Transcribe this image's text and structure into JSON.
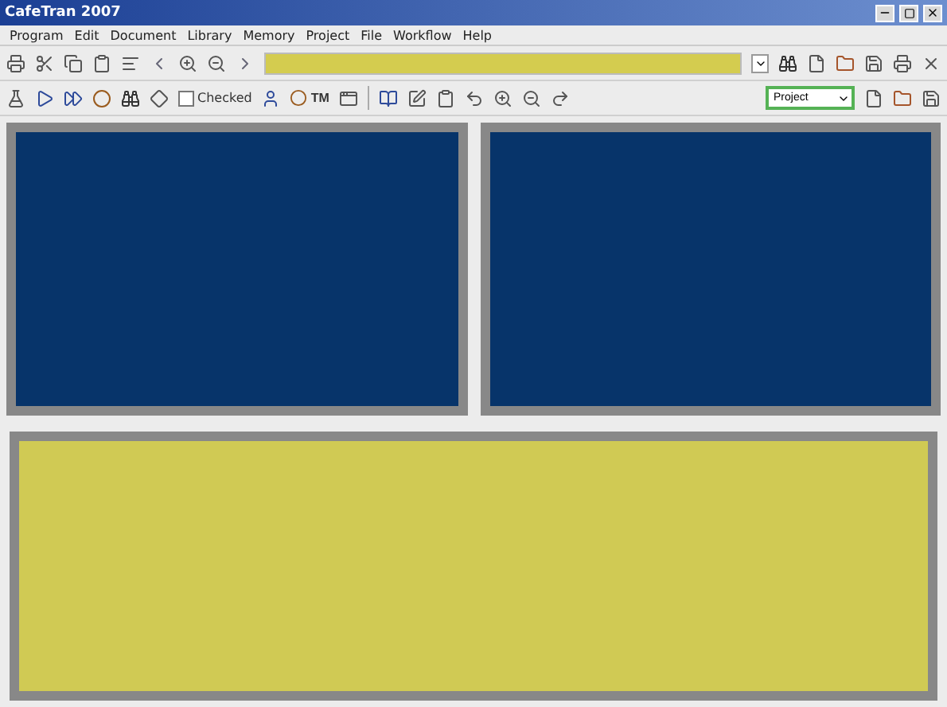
{
  "window": {
    "title": "CafeTran 2007"
  },
  "menu": [
    "Program",
    "Edit",
    "Document",
    "Library",
    "Memory",
    "Project",
    "File",
    "Workflow",
    "Help"
  ],
  "toolbar": {
    "checkbox": {
      "label": "Checked",
      "checked": false
    },
    "tm_button": {
      "label": "TM"
    },
    "combo": {
      "value": "Project"
    }
  }
}
